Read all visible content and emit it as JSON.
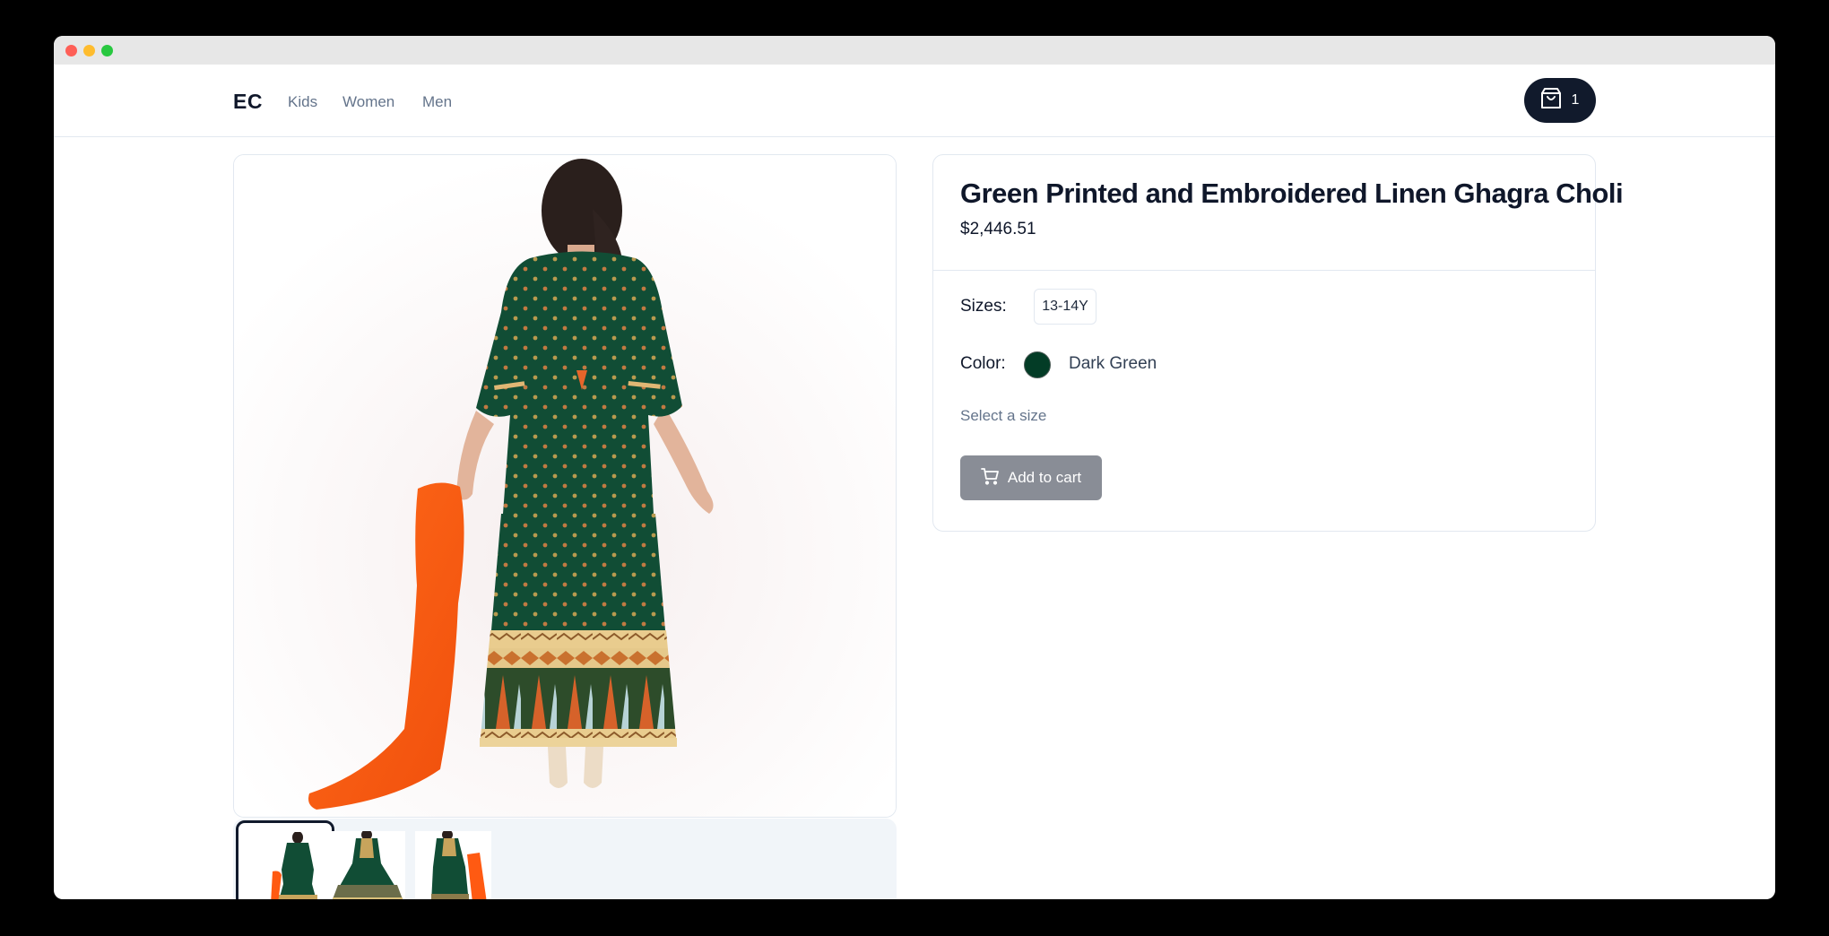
{
  "window": {
    "traffic_lights": [
      "close",
      "minimize",
      "maximize"
    ]
  },
  "header": {
    "logo": "EC",
    "nav": [
      {
        "label": "Kids"
      },
      {
        "label": "Women"
      },
      {
        "label": "Men"
      }
    ],
    "cart": {
      "icon": "shopping-bag-icon",
      "count": "1"
    }
  },
  "gallery": {
    "main_image_alt": "Green Printed and Embroidered Linen Ghagra Choli - back view",
    "thumbnails": [
      {
        "alt": "Back view",
        "selected": true
      },
      {
        "alt": "Front view twirl",
        "selected": false
      },
      {
        "alt": "Side view with dupatta",
        "selected": false
      }
    ]
  },
  "product": {
    "title": "Green Printed and Embroidered Linen Ghagra Choli",
    "price": "$2,446.51",
    "sizes_label": "Sizes:",
    "sizes": [
      "13-14Y"
    ],
    "color_label": "Color:",
    "color_name": "Dark Green",
    "color_hex": "#033c26",
    "hint": "Select a size",
    "add_to_cart": {
      "label": "Add to cart",
      "icon": "shopping-cart-icon",
      "disabled": true
    }
  }
}
